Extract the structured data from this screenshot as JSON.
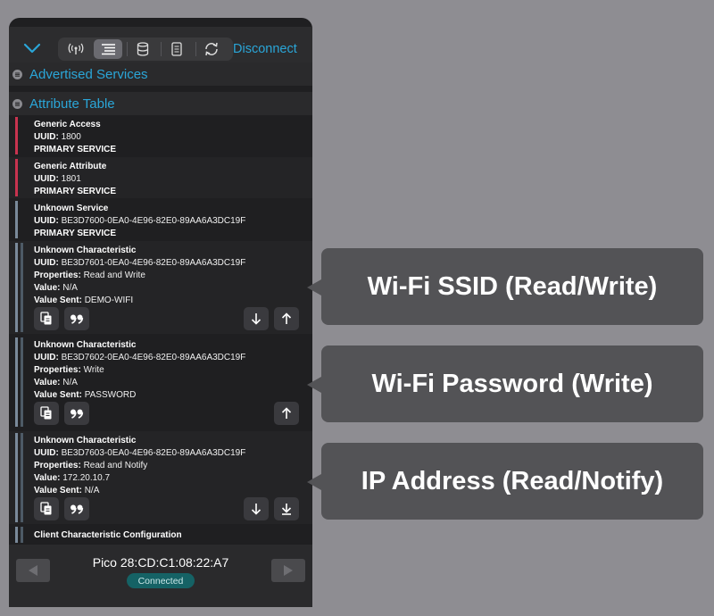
{
  "toolbar": {
    "disconnect_label": "Disconnect"
  },
  "sections": {
    "advertised": "Advertised Services",
    "attribute_table": "Attribute Table"
  },
  "services": [
    {
      "name": "Generic Access",
      "uuid_label": "UUID:",
      "uuid": "1800",
      "type": "PRIMARY SERVICE",
      "color": "#c8334f"
    },
    {
      "name": "Generic Attribute",
      "uuid_label": "UUID:",
      "uuid": "1801",
      "type": "PRIMARY SERVICE",
      "color": "#c8334f"
    },
    {
      "name": "Unknown Service",
      "uuid_label": "UUID:",
      "uuid": "BE3D7600-0EA0-4E96-82E0-89AA6A3DC19F",
      "type": "PRIMARY SERVICE",
      "color": "#7a8a9a"
    }
  ],
  "characteristics": [
    {
      "name": "Unknown Characteristic",
      "uuid_label": "UUID:",
      "uuid": "BE3D7601-0EA0-4E96-82E0-89AA6A3DC19F",
      "properties_label": "Properties:",
      "properties": "Read and Write",
      "value_label": "Value:",
      "value": "N/A",
      "sent_label": "Value Sent:",
      "sent": "DEMO-WIFI"
    },
    {
      "name": "Unknown Characteristic",
      "uuid_label": "UUID:",
      "uuid": "BE3D7602-0EA0-4E96-82E0-89AA6A3DC19F",
      "properties_label": "Properties:",
      "properties": "Write",
      "value_label": "Value:",
      "value": "N/A",
      "sent_label": "Value Sent:",
      "sent": "PASSWORD"
    },
    {
      "name": "Unknown Characteristic",
      "uuid_label": "UUID:",
      "uuid": "BE3D7603-0EA0-4E96-82E0-89AA6A3DC19F",
      "properties_label": "Properties:",
      "properties": "Read and Notify",
      "value_label": "Value:",
      "value": "172.20.10.7",
      "sent_label": "Value Sent:",
      "sent": "N/A"
    }
  ],
  "descriptor": {
    "name": "Client Characteristic Configuration"
  },
  "footer": {
    "device_name": "Pico 28:CD:C1:08:22:A7",
    "status": "Connected"
  },
  "callouts": [
    "Wi-Fi SSID (Read/Write)",
    "Wi-Fi Password (Write)",
    "IP Address (Read/Notify)"
  ],
  "icons": [
    "chevron-down-icon",
    "antenna-icon",
    "list-icon",
    "database-icon",
    "document-icon",
    "refresh-icon",
    "copy-icon",
    "quote-icon",
    "arrow-down-icon",
    "arrow-up-icon",
    "arrow-down-to-line-icon",
    "triangle-left-icon",
    "triangle-right-icon"
  ]
}
